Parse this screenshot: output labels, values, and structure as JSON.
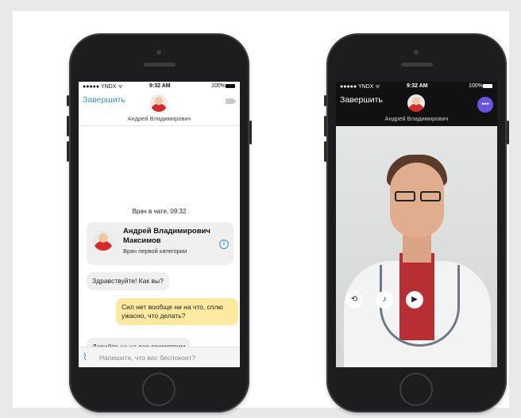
{
  "left_phone": {
    "status": {
      "carrier": "●●●●● YNDX ᯤ",
      "time": "9:32 AM",
      "battery_pct": "100%"
    },
    "header": {
      "end_label": "Завершить",
      "doctor_name": "Андрей Владимирович"
    },
    "chat": {
      "system_message": "Врач в чате, 09:32",
      "doctor_card": {
        "name": "Андрей Владимирович Максимов",
        "category": "Врач первой категории"
      },
      "messages": [
        {
          "from": "doctor",
          "text": "Здравствуйте! Как вы?"
        },
        {
          "from": "user",
          "text": "Сил нет вообще ни на что, сплю ужасно, что делать?"
        },
        {
          "from": "doctor",
          "text": "Давайте-ка на вас посмотрим"
        }
      ]
    },
    "input": {
      "placeholder": "Напишите, что вас беспокоит?"
    }
  },
  "right_phone": {
    "status": {
      "carrier": "●●●●● YNDX ᯤ",
      "time": "9:32 AM",
      "battery_pct": "100%"
    },
    "header": {
      "end_label": "Завершить",
      "doctor_name": "Андрей Владимирович"
    },
    "controls": [
      "camera-switch-icon",
      "microphone-icon",
      "video-camera-icon"
    ]
  },
  "colors": {
    "accent_blue": "#3a8fd6",
    "user_bubble": "#fde9a0",
    "chat_button": "#6a55e0"
  }
}
